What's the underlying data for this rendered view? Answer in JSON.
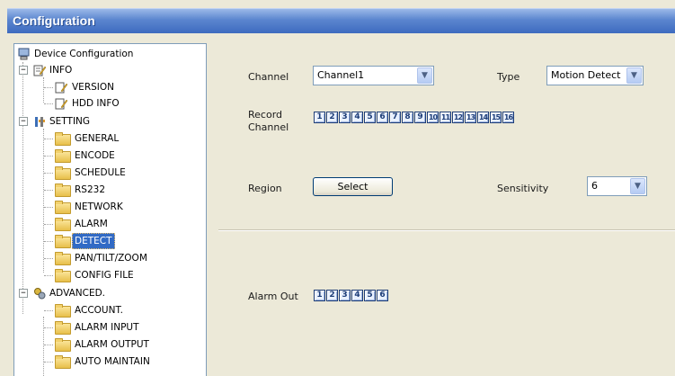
{
  "window": {
    "title": "Configuration"
  },
  "tree": {
    "root": "Device Configuration",
    "info": {
      "label": "INFO",
      "items": [
        "VERSION",
        "HDD INFO"
      ]
    },
    "setting": {
      "label": "SETTING",
      "items": [
        "GENERAL",
        "ENCODE",
        "SCHEDULE",
        "RS232",
        "NETWORK",
        "ALARM",
        "DETECT",
        "PAN/TILT/ZOOM",
        "CONFIG FILE"
      ]
    },
    "advanced": {
      "label": "ADVANCED.",
      "items": [
        "ACCOUNT.",
        "ALARM INPUT",
        "ALARM OUTPUT",
        "AUTO MAINTAIN"
      ]
    },
    "selected": "DETECT"
  },
  "form": {
    "channel_label": "Channel",
    "channel_value": "Channel1",
    "type_label": "Type",
    "type_value": "Motion Detect",
    "record_label_1": "Record",
    "record_label_2": "Channel",
    "record_channels": [
      "1",
      "2",
      "3",
      "4",
      "5",
      "6",
      "7",
      "8",
      "9",
      "10",
      "11",
      "12",
      "13",
      "14",
      "15",
      "16"
    ],
    "region_label": "Region",
    "select_button": "Select",
    "sensitivity_label": "Sensitivity",
    "sensitivity_value": "6",
    "alarm_out_label": "Alarm Out",
    "alarm_outputs": [
      "1",
      "2",
      "3",
      "4",
      "5",
      "6"
    ]
  },
  "colors": {
    "title_blue": "#3e6bbf",
    "selection": "#316ac5",
    "panel": "#ece9d8"
  }
}
